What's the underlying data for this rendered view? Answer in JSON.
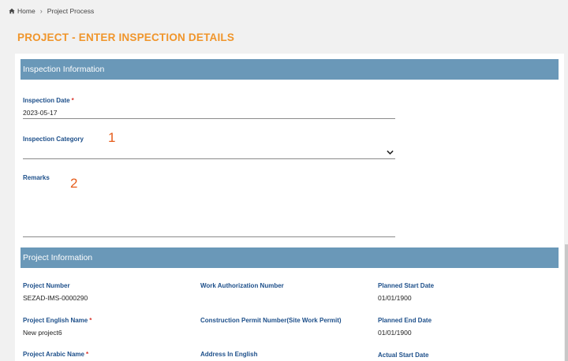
{
  "breadcrumb": {
    "home": "Home",
    "current": "Project Process"
  },
  "page_title": "PROJECT - ENTER INSPECTION DETAILS",
  "inspection_section": {
    "title": "Inspection Information",
    "inspection_date": {
      "label": "Inspection Date",
      "value": "2023-05-17"
    },
    "inspection_category": {
      "label": "Inspection Category",
      "value": ""
    },
    "remarks": {
      "label": "Remarks",
      "value": ""
    }
  },
  "annotations": {
    "one": "1",
    "two": "2"
  },
  "project_section": {
    "title": "Project Information",
    "fields": [
      {
        "label": "Project Number",
        "value": "SEZAD-IMS-0000290",
        "required": false
      },
      {
        "label": "Work Authorization Number",
        "value": "",
        "required": false
      },
      {
        "label": "Planned Start Date",
        "value": "01/01/1900",
        "required": false
      },
      {
        "label": "Project English Name",
        "value": "New project6",
        "required": true
      },
      {
        "label": "Construction Permit Number(Site Work Permit)",
        "value": "",
        "required": false
      },
      {
        "label": "Planned End Date",
        "value": "01/01/1900",
        "required": false
      },
      {
        "label": "Project Arabic Name",
        "value": "",
        "required": true
      },
      {
        "label": "Address In English",
        "value": "",
        "required": false
      },
      {
        "label": "Actual Start Date",
        "value": "",
        "required": false
      }
    ]
  },
  "required_marker": "*",
  "colors": {
    "title": "#f0952b",
    "header": "#6a98b8",
    "label": "#1d4f8a",
    "required": "#d9342b",
    "annotation": "#e65c1a"
  }
}
